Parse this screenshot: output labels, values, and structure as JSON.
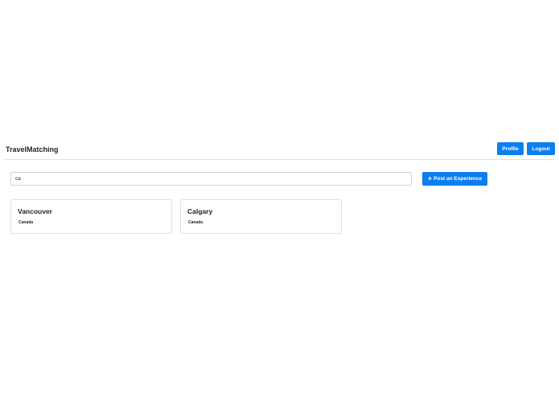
{
  "navbar": {
    "brand": "TravelMatching",
    "profile_label": "Profile",
    "logout_label": "Logout"
  },
  "search": {
    "value": "ca",
    "post_label": "Post an Experience"
  },
  "results": [
    {
      "city": "Vancouver",
      "country": "Canada"
    },
    {
      "city": "Calgary",
      "country": "Canada"
    }
  ],
  "colors": {
    "primary": "#0d7ef0",
    "border": "#dee2e6",
    "text": "#212529"
  }
}
